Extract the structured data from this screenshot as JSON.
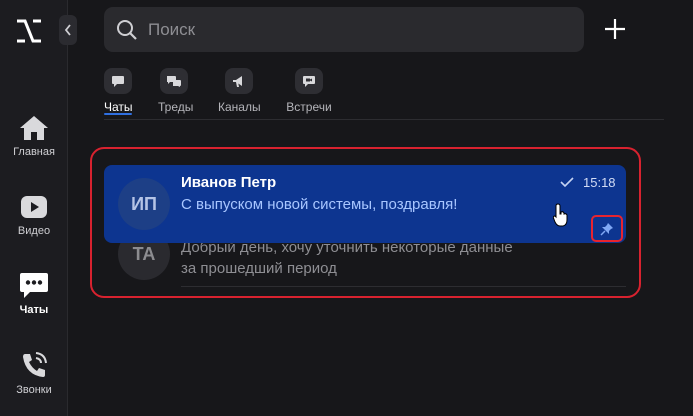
{
  "rail": {
    "items": [
      {
        "label": "Главная",
        "icon": "home-icon"
      },
      {
        "label": "Видео",
        "icon": "video-icon"
      },
      {
        "label": "Чаты",
        "icon": "chat-icon"
      },
      {
        "label": "Звонки",
        "icon": "phone-icon"
      }
    ],
    "active": "Чаты"
  },
  "search": {
    "placeholder": "Поиск"
  },
  "tabs": [
    {
      "label": "Чаты",
      "icon": "chat-bubble-icon"
    },
    {
      "label": "Треды",
      "icon": "threads-icon"
    },
    {
      "label": "Каналы",
      "icon": "megaphone-icon"
    },
    {
      "label": "Встречи",
      "icon": "meeting-icon"
    }
  ],
  "chats": [
    {
      "initials": "ИП",
      "name": "Иванов Петр",
      "preview": "С выпуском новой системы, поздравля!",
      "time": "15:18",
      "read": true,
      "pinned": true
    },
    {
      "initials": "ТА",
      "preview_line1": "Добрый день, хочу уточнить некоторые данные",
      "preview_line2": "за прошедший период"
    }
  ],
  "colors": {
    "accent": "#2f6fe0",
    "selected_row": "#0d3590",
    "annotation": "#d8222f"
  }
}
